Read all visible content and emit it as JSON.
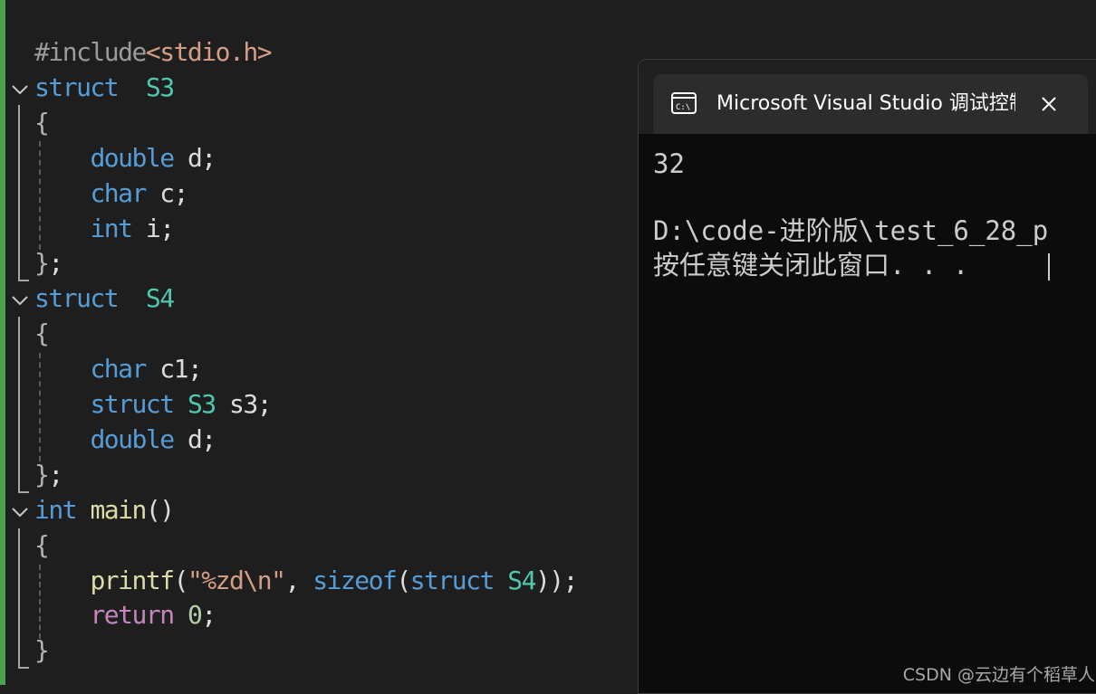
{
  "editor": {
    "lines": [
      {
        "n": 0,
        "segs": [
          [
            "pp",
            "#include"
          ],
          [
            "st",
            "<stdio.h>"
          ]
        ]
      },
      {
        "n": 1,
        "segs": [
          [
            "kw",
            "struct"
          ],
          [
            "",
            "  "
          ],
          [
            "ty",
            "S3"
          ]
        ]
      },
      {
        "n": 2,
        "segs": [
          [
            "br",
            "{"
          ]
        ]
      },
      {
        "n": 3,
        "segs": [
          [
            "",
            "    "
          ],
          [
            "kw",
            "double"
          ],
          [
            "",
            " d;"
          ]
        ]
      },
      {
        "n": 4,
        "segs": [
          [
            "",
            "    "
          ],
          [
            "kw",
            "char"
          ],
          [
            "",
            " c;"
          ]
        ]
      },
      {
        "n": 5,
        "segs": [
          [
            "",
            "    "
          ],
          [
            "kw",
            "int"
          ],
          [
            "",
            " i;"
          ]
        ]
      },
      {
        "n": 6,
        "segs": [
          [
            "br",
            "}"
          ],
          [
            "",
            ";"
          ]
        ]
      },
      {
        "n": 7,
        "segs": [
          [
            "kw",
            "struct"
          ],
          [
            "",
            "  "
          ],
          [
            "ty",
            "S4"
          ]
        ]
      },
      {
        "n": 8,
        "segs": [
          [
            "br",
            "{"
          ]
        ]
      },
      {
        "n": 9,
        "segs": [
          [
            "",
            "    "
          ],
          [
            "kw",
            "char"
          ],
          [
            "",
            " c1;"
          ]
        ]
      },
      {
        "n": 10,
        "segs": [
          [
            "",
            "    "
          ],
          [
            "kw",
            "struct"
          ],
          [
            "",
            " "
          ],
          [
            "ty",
            "S3"
          ],
          [
            "",
            " s3;"
          ]
        ]
      },
      {
        "n": 11,
        "segs": [
          [
            "",
            "    "
          ],
          [
            "kw",
            "double"
          ],
          [
            "",
            " d;"
          ]
        ]
      },
      {
        "n": 12,
        "segs": [
          [
            "br",
            "}"
          ],
          [
            "",
            ";"
          ]
        ]
      },
      {
        "n": 13,
        "segs": [
          [
            "kw",
            "int"
          ],
          [
            "",
            " "
          ],
          [
            "fn",
            "main"
          ],
          [
            "",
            "()"
          ]
        ]
      },
      {
        "n": 14,
        "segs": [
          [
            "br",
            "{"
          ]
        ]
      },
      {
        "n": 15,
        "segs": [
          [
            "",
            "    "
          ],
          [
            "fn",
            "printf"
          ],
          [
            "",
            "("
          ],
          [
            "st",
            "\"%zd\\n\""
          ],
          [
            "",
            ", "
          ],
          [
            "kw",
            "sizeof"
          ],
          [
            "",
            "("
          ],
          [
            "kw",
            "struct"
          ],
          [
            "",
            " "
          ],
          [
            "ty",
            "S4"
          ],
          [
            "",
            "));"
          ]
        ]
      },
      {
        "n": 16,
        "segs": [
          [
            "",
            "    "
          ],
          [
            "ct",
            "return"
          ],
          [
            "",
            " "
          ],
          [
            "nm",
            "0"
          ],
          [
            "",
            ";"
          ]
        ]
      },
      {
        "n": 17,
        "segs": [
          [
            "br",
            "}"
          ]
        ]
      }
    ]
  },
  "console": {
    "title": "Microsoft Visual Studio 调试控制台",
    "icon": "console-app-icon",
    "output": [
      "32",
      "",
      "D:\\code-进阶版\\test_6_28_p",
      "按任意键关闭此窗口. . ."
    ]
  },
  "watermark": "CSDN @云边有个稻草人"
}
